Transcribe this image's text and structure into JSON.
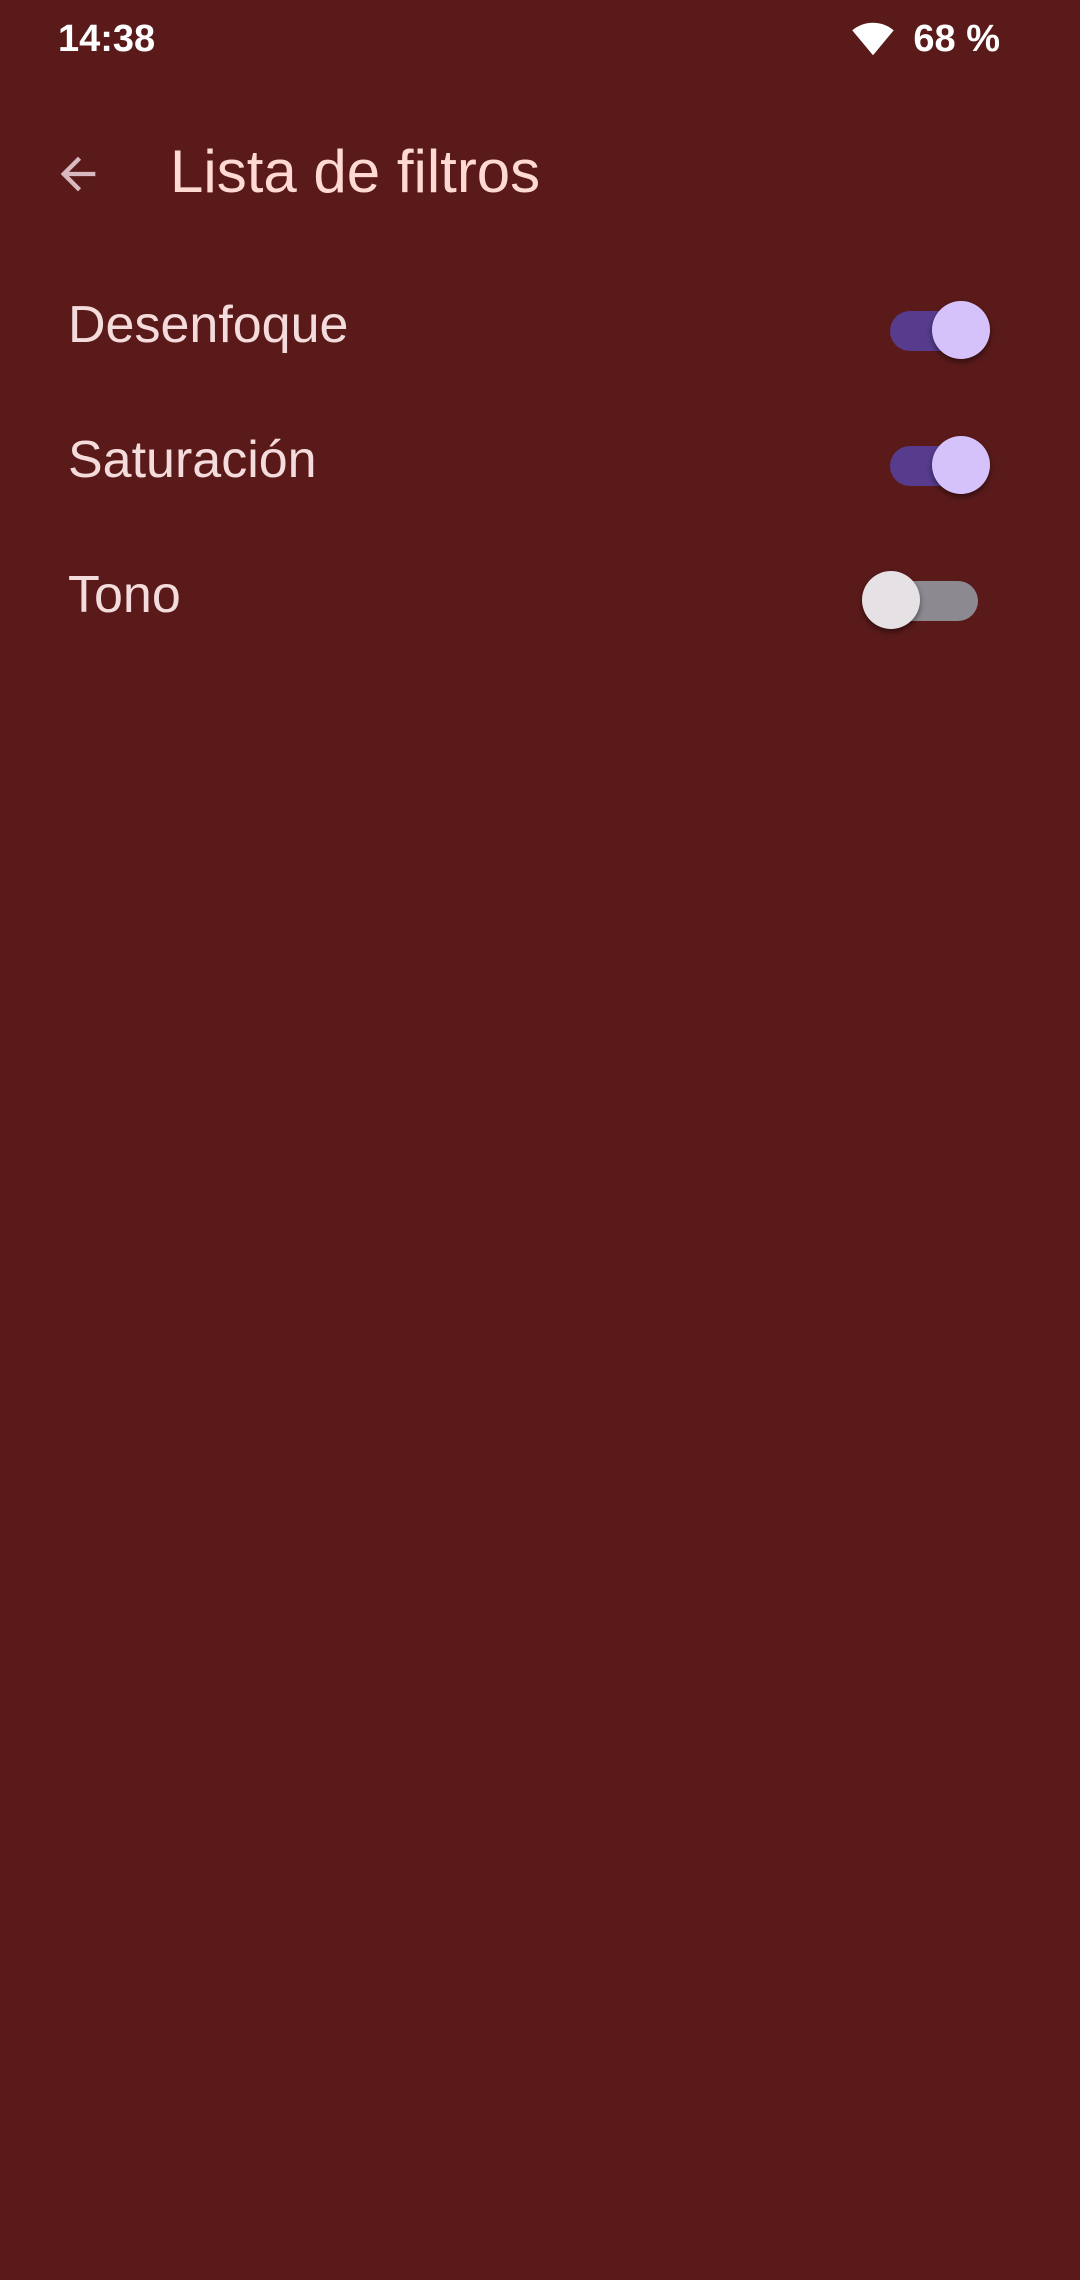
{
  "status_bar": {
    "time": "14:38",
    "battery": "68 %",
    "wifi_icon": "wifi-icon"
  },
  "app_bar": {
    "back_icon": "arrow-back-icon",
    "title": "Lista de filtros"
  },
  "filters": [
    {
      "label": "Desenfoque",
      "enabled": true
    },
    {
      "label": "Saturación",
      "enabled": true
    },
    {
      "label": "Tono",
      "enabled": false
    }
  ],
  "colors": {
    "background": "#5a1a1a",
    "title_text": "#ffd9d4",
    "label_text": "#f5dcdc",
    "switch_on_track": "#573c8e",
    "switch_on_thumb": "#d6c2fb",
    "switch_off_track": "#8c8a90",
    "switch_off_thumb": "#e6e1e5"
  }
}
